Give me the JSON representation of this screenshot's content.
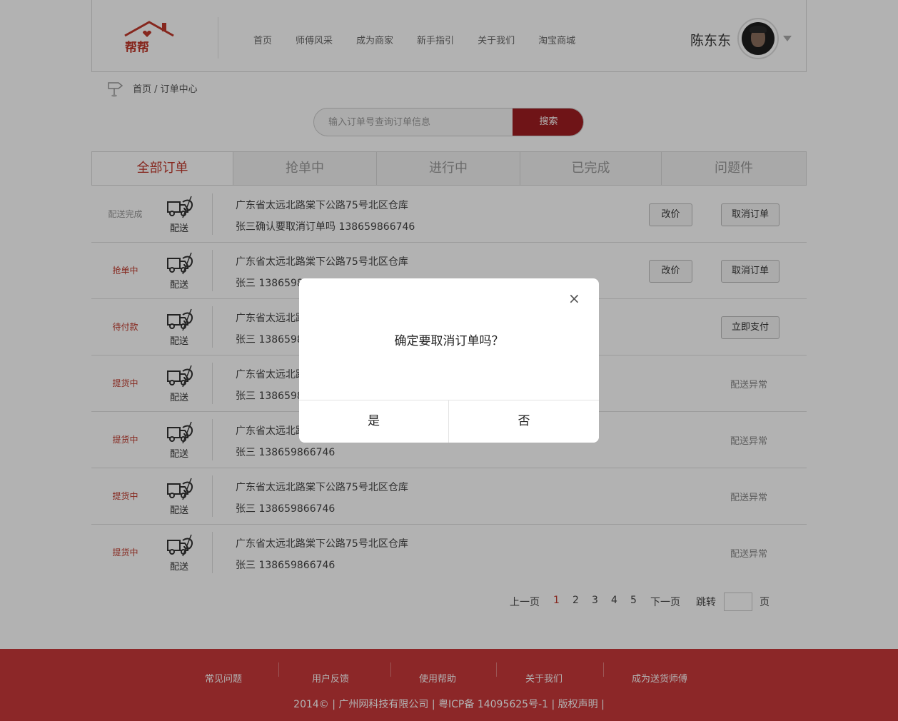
{
  "header": {
    "logo_text": "帮帮",
    "nav": [
      "首页",
      "师傅风采",
      "成为商家",
      "新手指引",
      "关于我们",
      "淘宝商城"
    ],
    "username": "陈东东"
  },
  "breadcrumb": "首页 / 订单中心",
  "search": {
    "placeholder": "输入订单号查询订单信息",
    "button": "搜索"
  },
  "tabs": [
    "全部订单",
    "抢单中",
    "进行中",
    "已完成",
    "问题件"
  ],
  "delivery_label": "配送",
  "orders": [
    {
      "status": "配送完成",
      "status_color": "#999999",
      "address": "广东省太远北路棠下公路75号北区仓库",
      "contact": "张三确认要取消订单吗  138659866746",
      "price_btn": "改价",
      "action": "取消订单"
    },
    {
      "status": "抢单中",
      "status_color": "#c0392b",
      "address": "广东省太远北路棠下公路75号北区仓库",
      "contact": "张三  138659866746",
      "price_btn": "改价",
      "action": "取消订单"
    },
    {
      "status": "待付款",
      "status_color": "#c0392b",
      "address": "广东省太远北路棠下公路75号北区仓库",
      "contact": "张三  138659866746",
      "action": "立即支付"
    },
    {
      "status": "提货中",
      "status_color": "#c0392b",
      "address": "广东省太远北路棠下公路75号北区仓库",
      "contact": "张三  138659866746",
      "note": "配送异常"
    },
    {
      "status": "提货中",
      "status_color": "#c0392b",
      "address": "广东省太远北路棠下公路75号北区仓库",
      "contact": "张三  138659866746",
      "note": "配送异常"
    },
    {
      "status": "提货中",
      "status_color": "#c0392b",
      "address": "广东省太远北路棠下公路75号北区仓库",
      "contact": "张三  138659866746",
      "note": "配送异常"
    },
    {
      "status": "提货中",
      "status_color": "#c0392b",
      "address": "广东省太远北路棠下公路75号北区仓库",
      "contact": "张三  138659866746",
      "note": "配送异常"
    }
  ],
  "pager": {
    "prev": "上一页",
    "pages": [
      "1",
      "2",
      "3",
      "4",
      "5"
    ],
    "current": "1",
    "next": "下一页",
    "jump": "跳转",
    "page_unit": "页"
  },
  "footer": {
    "links": [
      "常见问题",
      "用户反馈",
      "使用帮助",
      "关于我们",
      "成为送货师傅"
    ],
    "copyright": "2014©  |  广州网科技有限公司  |  粤ICP备 14095625号-1  |  版权声明  |"
  },
  "dialog": {
    "close": "×",
    "message": "确定要取消订单吗？",
    "yes": "是",
    "no": "否"
  },
  "colors": {
    "brand_red": "#a01e21",
    "footer_red": "#c9383a",
    "active_tab": "#c0392b"
  }
}
